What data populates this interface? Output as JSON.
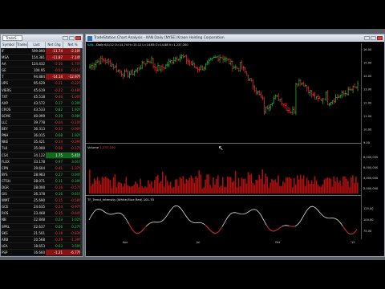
{
  "radar": {
    "tab_label": "TradeS...",
    "headers": {
      "symbol": "Symbol",
      "trades": "Trades",
      "last": "Last",
      "net_chg": "Net Chg",
      "net_pct": "Net %"
    },
    "rows": [
      {
        "symbol": "IF",
        "last": "599.890",
        "chg": "-11.74",
        "pct": "-2.10%",
        "dir": "dn",
        "hl": "dn"
      },
      {
        "symbol": "MSA",
        "last": "154.381",
        "chg": "-11.87",
        "pct": "-7.14%",
        "dir": "dn",
        "hl": "dn"
      },
      {
        "symbol": "AA",
        "last": "124.432",
        "chg": "-2.16",
        "pct": "-1.70%",
        "dir": "dn",
        "hl": ""
      },
      {
        "symbol": "GE",
        "last": "104.95",
        "chg": "-0.54",
        "pct": "-0.51%",
        "dir": "dn",
        "hl": ""
      },
      {
        "symbol": "T",
        "last": "94.884",
        "chg": "-14.14",
        "pct": "-12.97%",
        "dir": "dn",
        "hl": "dn"
      },
      {
        "symbol": "UPS",
        "last": "95.629",
        "chg": "-0.21",
        "pct": "-0.22%",
        "dir": "dn",
        "hl": ""
      },
      {
        "symbol": "VIERS",
        "last": "45.619",
        "chg": "-0.22",
        "pct": "-0.48%",
        "dir": "dn",
        "hl": ""
      },
      {
        "symbol": "TXT",
        "last": "45.518",
        "chg": "-0.46",
        "pct": "-1.00%",
        "dir": "dn",
        "hl": ""
      },
      {
        "symbol": "AXP",
        "last": "43.572",
        "chg": "0.17",
        "pct": "0.39%",
        "dir": "up",
        "hl": ""
      },
      {
        "symbol": "CROS",
        "last": "43.533",
        "chg": "0.82",
        "pct": "1.92%",
        "dir": "up",
        "hl": ""
      },
      {
        "symbol": "SCMC",
        "last": "40.099",
        "chg": "0.39",
        "pct": "0.98%",
        "dir": "up",
        "hl": ""
      },
      {
        "symbol": "LLC",
        "last": "39.778",
        "chg": "-0.04",
        "pct": "-0.10%",
        "dir": "dn",
        "hl": ""
      },
      {
        "symbol": "BEY",
        "last": "36.313",
        "chg": "-0.33",
        "pct": "-0.90%",
        "dir": "dn",
        "hl": ""
      },
      {
        "symbol": "PNH",
        "last": "36.015",
        "chg": "0.68",
        "pct": "1.92%",
        "dir": "up",
        "hl": ""
      },
      {
        "symbol": "NKE",
        "last": "35.421",
        "chg": "-0.14",
        "pct": "-0.39%",
        "dir": "dn",
        "hl": ""
      },
      {
        "symbol": "TLK",
        "last": "35.000",
        "chg": "-0.06",
        "pct": "-0.17%",
        "dir": "dn",
        "hl": ""
      },
      {
        "symbol": "CSX",
        "last": "34.122",
        "chg": "1.75",
        "pct": "5.41%",
        "dir": "up",
        "hl": "up"
      },
      {
        "symbol": "FLEX",
        "last": "33.178",
        "chg": "0.97",
        "pct": "3.01%",
        "dir": "up",
        "hl": ""
      },
      {
        "symbol": "CPN",
        "last": "29.604",
        "chg": "-0.41",
        "pct": "-1.37%",
        "dir": "dn",
        "hl": ""
      },
      {
        "symbol": "BYS",
        "last": "28.983",
        "chg": "0.27",
        "pct": "0.94%",
        "dir": "up",
        "hl": ""
      },
      {
        "symbol": "CTSH",
        "last": "28.071",
        "chg": "0.11",
        "pct": "0.39%",
        "dir": "up",
        "hl": ""
      },
      {
        "symbol": "DGR",
        "last": "28.000",
        "chg": "-0.16",
        "pct": "-0.57%",
        "dir": "dn",
        "hl": ""
      },
      {
        "symbol": "GIS",
        "last": "26.378",
        "chg": "0.16",
        "pct": "0.61%",
        "dir": "up",
        "hl": ""
      },
      {
        "symbol": "WMT",
        "last": "25.690",
        "chg": "-0.15",
        "pct": "-0.58%",
        "dir": "dn",
        "hl": ""
      },
      {
        "symbol": "GCE",
        "last": "24.635",
        "chg": "-0.24",
        "pct": "-0.97%",
        "dir": "dn",
        "hl": ""
      },
      {
        "symbol": "ROS",
        "last": "23.468",
        "chg": "-0.15",
        "pct": "-0.64%",
        "dir": "dn",
        "hl": ""
      },
      {
        "symbol": "NB",
        "last": "22.848",
        "chg": "0.23",
        "pct": "1.02%",
        "dir": "up",
        "hl": ""
      },
      {
        "symbol": "SPRL",
        "last": "22.637",
        "chg": "0.06",
        "pct": "0.27%",
        "dir": "up",
        "hl": ""
      },
      {
        "symbol": "SKS",
        "last": "21.501",
        "chg": "-0.18",
        "pct": "-0.83%",
        "dir": "dn",
        "hl": ""
      },
      {
        "symbol": "ARB",
        "last": "20.568",
        "chg": "-0.29",
        "pct": "-1.39%",
        "dir": "dn",
        "hl": ""
      },
      {
        "symbol": "LEA",
        "last": "18.653",
        "chg": "0.63",
        "pct": "3.50%",
        "dir": "up",
        "hl": ""
      },
      {
        "symbol": "PSP",
        "last": "16.660",
        "chg": "-1.21",
        "pct": "-6.77%",
        "dir": "dn",
        "hl": "dn"
      }
    ]
  },
  "chart": {
    "window_title": "TradeStation Chart Analysis - KAN Daily [NYSE] Kraon Holding Corporation",
    "legend_symbol": "KAN",
    "legend_text": "- Daily  6/1/12  O=14.74  H=15.12  L=14.65  C=14.88  V=1,237,200",
    "volume_label": "Volume",
    "volume_value": "1,237,200",
    "indicator_label": "TF_Trend_Intensity (White,Blue,Red)",
    "indicator_value": "101.70",
    "price_ticks": [
      "16.00",
      "15.00",
      "14.00",
      "13.00",
      "12.00",
      "11.00",
      "10.00",
      "9.00"
    ],
    "volume_ticks": [
      "8,000,000",
      "6,000,000",
      "4,000,000",
      "2,000,000"
    ],
    "indicator_ticks": [
      "125.00",
      "100.00",
      "75.00"
    ],
    "x_ticks": [
      "Apr",
      "Jul",
      "Oct",
      "'12"
    ],
    "colors": {
      "up": "#28c83a",
      "down": "#ff2b2b",
      "volume": "#b01010",
      "indicator": "#ffffff",
      "indicator_low": "#e01818"
    }
  }
}
